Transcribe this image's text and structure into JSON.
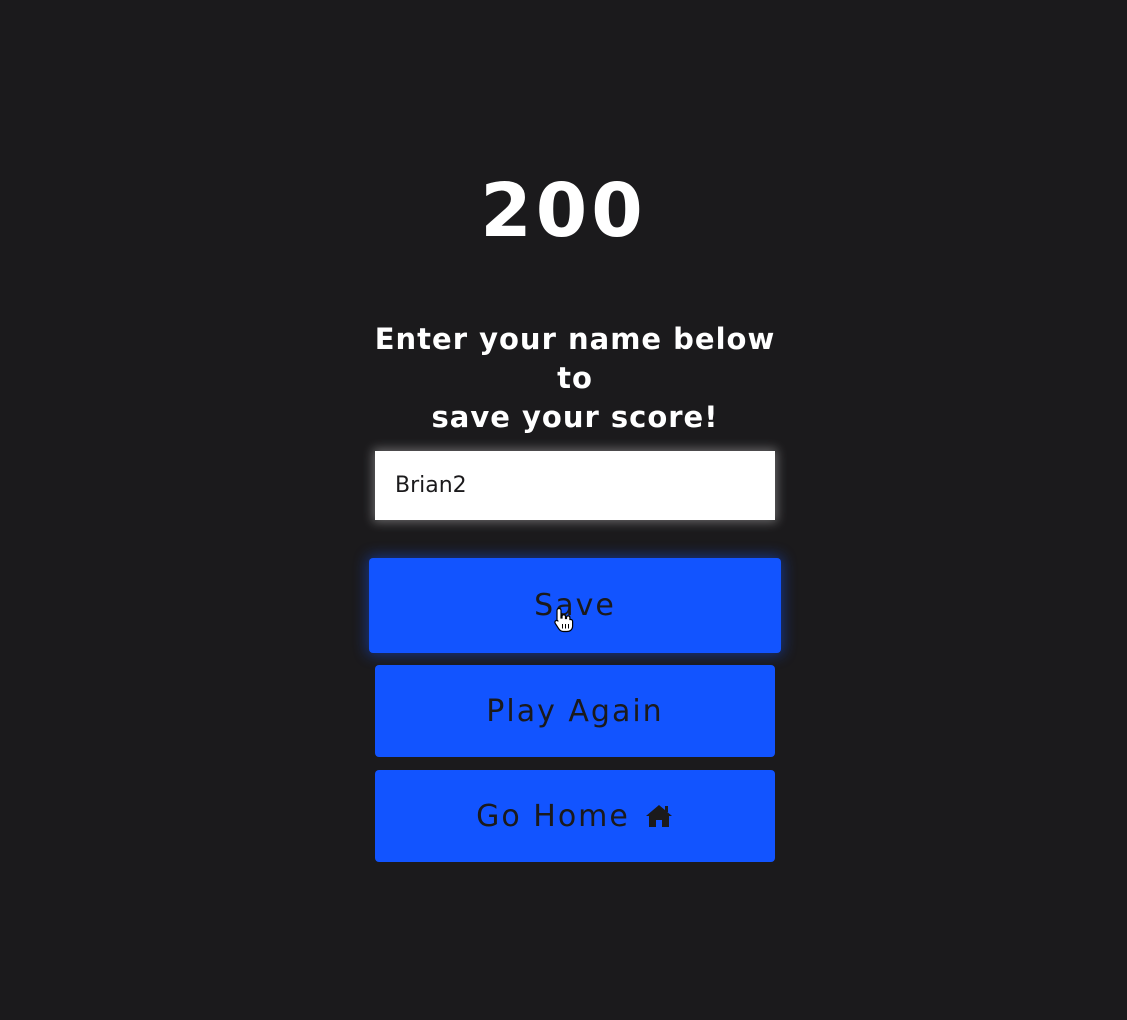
{
  "score": "200",
  "prompt": {
    "line1": "Enter your name below to",
    "line2": "save your score!"
  },
  "name_input": {
    "value": "Brian2",
    "placeholder": ""
  },
  "buttons": {
    "save_label": "Save",
    "play_again_label": "Play Again",
    "go_home_label": "Go Home"
  },
  "icons": {
    "go_home": "home-icon",
    "cursor": "hand-pointer-cursor-icon"
  },
  "colors": {
    "background": "#1b1a1c",
    "accent": "#1254ff",
    "text": "#ffffff",
    "button_text": "#1b1a1c"
  }
}
